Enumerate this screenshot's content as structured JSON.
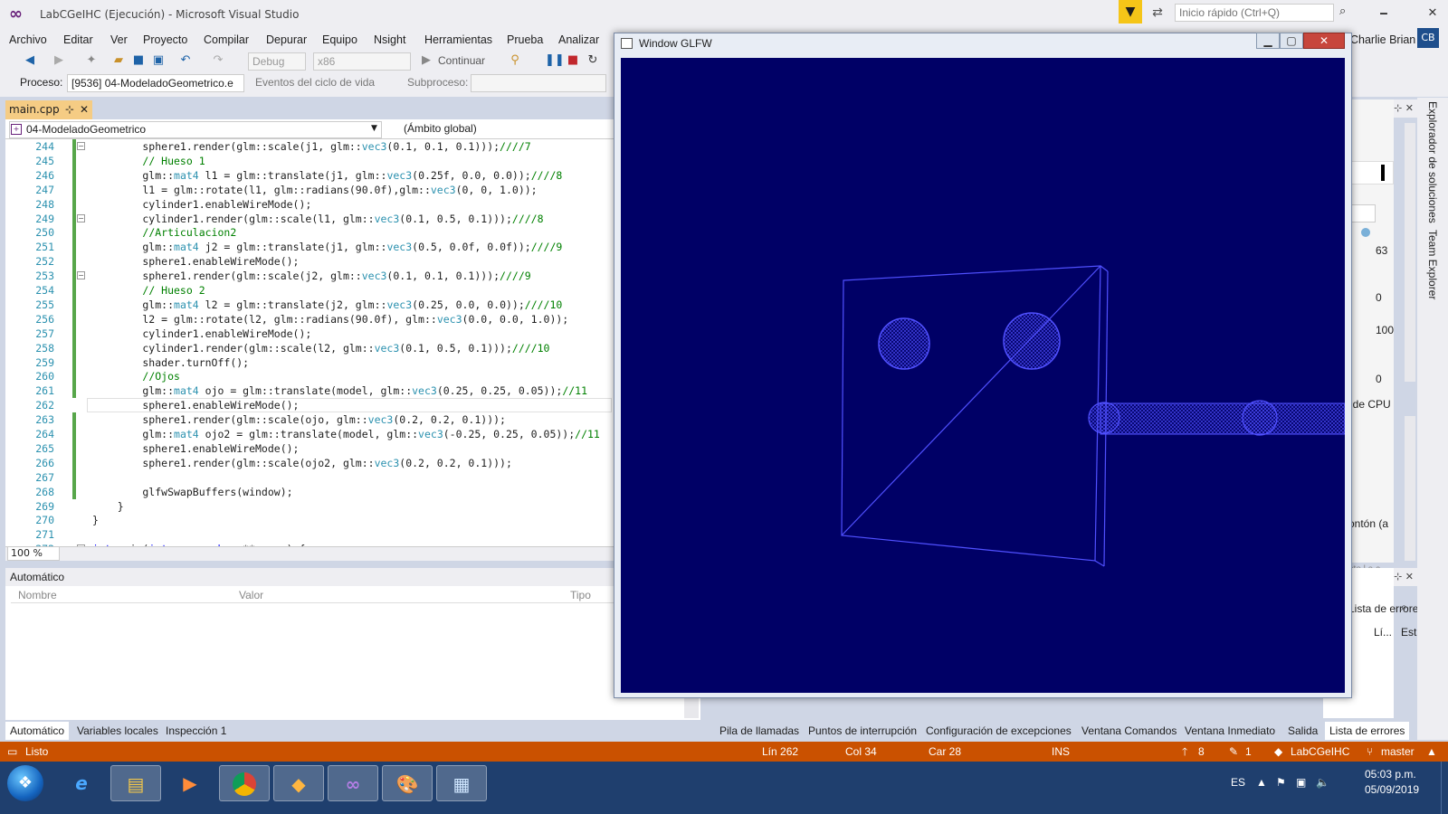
{
  "window": {
    "title": "LabCGeIHC (Ejecución) - Microsoft Visual Studio",
    "quick_launch_placeholder": "Inicio rápido (Ctrl+Q)",
    "minimize": "🗕",
    "maximize": "🗗",
    "close": "✕"
  },
  "menu": [
    "Archivo",
    "Editar",
    "Ver",
    "Proyecto",
    "Compilar",
    "Depurar",
    "Equipo",
    "Nsight",
    "Herramientas",
    "Prueba",
    "Analizar"
  ],
  "user": {
    "name": "Charlie Brian",
    "initials": "CB"
  },
  "toolbar": {
    "config": "Debug",
    "platform": "x86",
    "continue_label": "Continuar"
  },
  "toolbar2": {
    "process_label": "Proceso:",
    "process_value": "[9536] 04-ModeladoGeometrico.e",
    "lifecycle_label": "Eventos del ciclo de vida",
    "thread_label": "Subproceso:"
  },
  "editor": {
    "tab": "main.cpp",
    "project_scope": "04-ModeladoGeometrico",
    "global_scope": "(Ámbito global)",
    "zoom": "100 %",
    "lines": [
      {
        "n": "244",
        "code": "        sphere1.render(glm::scale(j1, glm::vec3(0.1, 0.1, 0.1)));////7"
      },
      {
        "n": "245",
        "code": "        // Hueso 1"
      },
      {
        "n": "246",
        "code": "        glm::mat4 l1 = glm::translate(j1, glm::vec3(0.25f, 0.0, 0.0));////8"
      },
      {
        "n": "247",
        "code": "        l1 = glm::rotate(l1, glm::radians(90.0f),glm::vec3(0, 0, 1.0));"
      },
      {
        "n": "248",
        "code": "        cylinder1.enableWireMode();"
      },
      {
        "n": "249",
        "code": "        cylinder1.render(glm::scale(l1, glm::vec3(0.1, 0.5, 0.1)));////8"
      },
      {
        "n": "250",
        "code": "        //Articulacion2"
      },
      {
        "n": "251",
        "code": "        glm::mat4 j2 = glm::translate(j1, glm::vec3(0.5, 0.0f, 0.0f));////9"
      },
      {
        "n": "252",
        "code": "        sphere1.enableWireMode();"
      },
      {
        "n": "253",
        "code": "        sphere1.render(glm::scale(j2, glm::vec3(0.1, 0.1, 0.1)));////9"
      },
      {
        "n": "254",
        "code": "        // Hueso 2"
      },
      {
        "n": "255",
        "code": "        glm::mat4 l2 = glm::translate(j2, glm::vec3(0.25, 0.0, 0.0));////10"
      },
      {
        "n": "256",
        "code": "        l2 = glm::rotate(l2, glm::radians(90.0f), glm::vec3(0.0, 0.0, 1.0));"
      },
      {
        "n": "257",
        "code": "        cylinder1.enableWireMode();"
      },
      {
        "n": "258",
        "code": "        cylinder1.render(glm::scale(l2, glm::vec3(0.1, 0.5, 0.1)));////10"
      },
      {
        "n": "259",
        "code": "        shader.turnOff();"
      },
      {
        "n": "260",
        "code": "        //Ojos"
      },
      {
        "n": "261",
        "code": "        glm::mat4 ojo = glm::translate(model, glm::vec3(0.25, 0.25, 0.05));//11"
      },
      {
        "n": "262",
        "code": "        sphere1.enableWireMode();"
      },
      {
        "n": "263",
        "code": "        sphere1.render(glm::scale(ojo, glm::vec3(0.2, 0.2, 0.1)));"
      },
      {
        "n": "264",
        "code": "        glm::mat4 ojo2 = glm::translate(model, glm::vec3(-0.25, 0.25, 0.05));//11"
      },
      {
        "n": "265",
        "code": "        sphere1.enableWireMode();"
      },
      {
        "n": "266",
        "code": "        sphere1.render(glm::scale(ojo2, glm::vec3(0.2, 0.2, 0.1)));"
      },
      {
        "n": "267",
        "code": ""
      },
      {
        "n": "268",
        "code": "        glfwSwapBuffers(window);"
      },
      {
        "n": "269",
        "code": "    }"
      },
      {
        "n": "270",
        "code": "}"
      },
      {
        "n": "271",
        "code": ""
      },
      {
        "n": "272",
        "code": "int main(int argc, char ** argv) {"
      }
    ]
  },
  "autos": {
    "title": "Automático",
    "col_name": "Nombre",
    "col_value": "Valor",
    "col_type": "Tipo"
  },
  "bottom_tabs_left": [
    "Automático",
    "Variables locales",
    "Inspección 1"
  ],
  "bottom_tabs_right": [
    "Pila de llamadas",
    "Puntos de interrupción",
    "Configuración de excepciones",
    "Ventana Comandos",
    "Ventana Inmediato",
    "Salida",
    "Lista de errores"
  ],
  "status": {
    "ready": "Listo",
    "line": "Lín 262",
    "col": "Col 34",
    "car": "Car 28",
    "ins": "INS",
    "up": "8",
    "pencil": "1",
    "repo": "LabCGeIHC",
    "branch": "master"
  },
  "right_panel": {
    "val1": "63",
    "val2": "0",
    "val3": "100",
    "val4": "0",
    "cpu": "Uso de CPU",
    "monton": "montón (a",
    "errors": "Lista de errores",
    "col_li": "Lí...",
    "col_est": "Esta",
    "partial": "hte l a c"
  },
  "side_tabs": [
    "Explorador de soluciones",
    "Team Explorer"
  ],
  "glfw": {
    "title": "Window GLFW",
    "bg": "#000066",
    "wire": "#5050ff"
  },
  "tray": {
    "lang": "ES",
    "time": "05:03 p.m.",
    "date": "05/09/2019"
  },
  "colors": {
    "status_bar": "#ca5100",
    "vs_purple": "#68217a",
    "active_tab": "#f5cc84"
  }
}
